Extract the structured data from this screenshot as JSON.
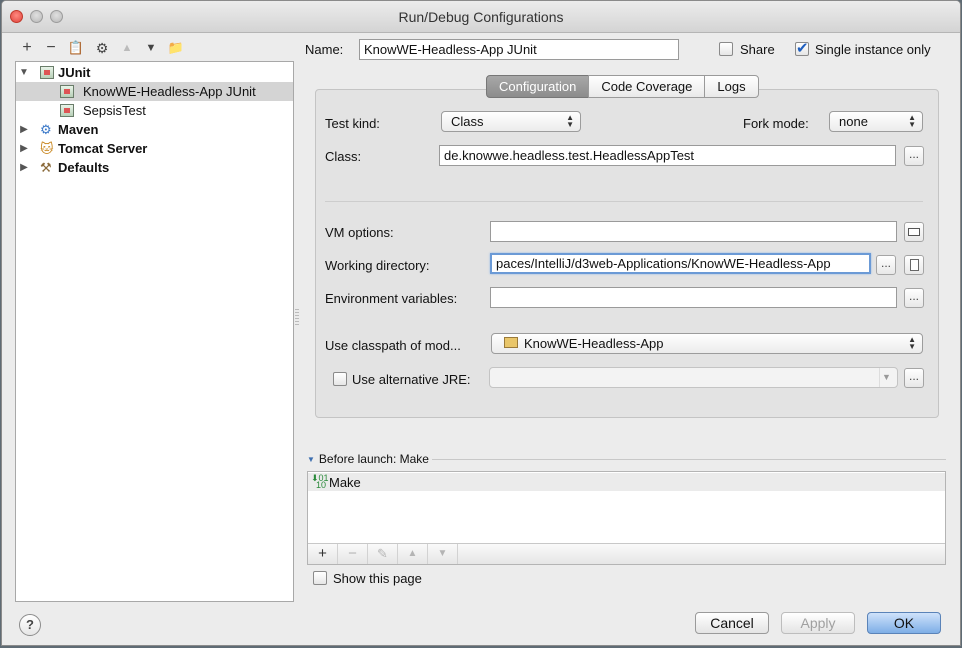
{
  "window": {
    "title": "Run/Debug Configurations"
  },
  "tree_toolbar": {
    "add": "+",
    "remove": "−",
    "copy": "📋",
    "settings": "⚙",
    "up": "▲",
    "down": "▼",
    "folder": "📁"
  },
  "tree": {
    "junit": "JUnit",
    "item_headless": "KnowWE-Headless-App JUnit",
    "item_sepsis": "SepsisTest",
    "maven": "Maven",
    "tomcat": "Tomcat Server",
    "defaults": "Defaults"
  },
  "header": {
    "name_label": "Name:",
    "name_value": "KnowWE-Headless-App JUnit",
    "share_label": "Share",
    "share_checked": false,
    "single_instance_label": "Single instance only",
    "single_instance_checked": true
  },
  "tabs": [
    "Configuration",
    "Code Coverage",
    "Logs"
  ],
  "config": {
    "test_kind_label": "Test kind:",
    "test_kind_value": "Class",
    "fork_mode_label": "Fork mode:",
    "fork_mode_value": "none",
    "class_label": "Class:",
    "class_value": "de.knowwe.headless.test.HeadlessAppTest",
    "vm_options_label": "VM options:",
    "vm_options_value": "",
    "working_dir_label": "Working directory:",
    "working_dir_value": "paces/IntelliJ/d3web-Applications/KnowWE-Headless-App",
    "env_vars_label": "Environment variables:",
    "env_vars_value": "",
    "classpath_label": "Use classpath of mod...",
    "classpath_value": "KnowWE-Headless-App",
    "alt_jre_label": "Use alternative JRE:",
    "alt_jre_checked": false,
    "alt_jre_value": "",
    "ellipsis": "..."
  },
  "before_launch": {
    "title": "Before launch: Make",
    "items": [
      "Make"
    ],
    "add": "+",
    "remove": "−",
    "edit": "✎",
    "up": "▲",
    "down": "▼",
    "show_page_label": "Show this page",
    "show_page_checked": false
  },
  "footer": {
    "help": "?",
    "cancel": "Cancel",
    "apply": "Apply",
    "ok": "OK"
  }
}
